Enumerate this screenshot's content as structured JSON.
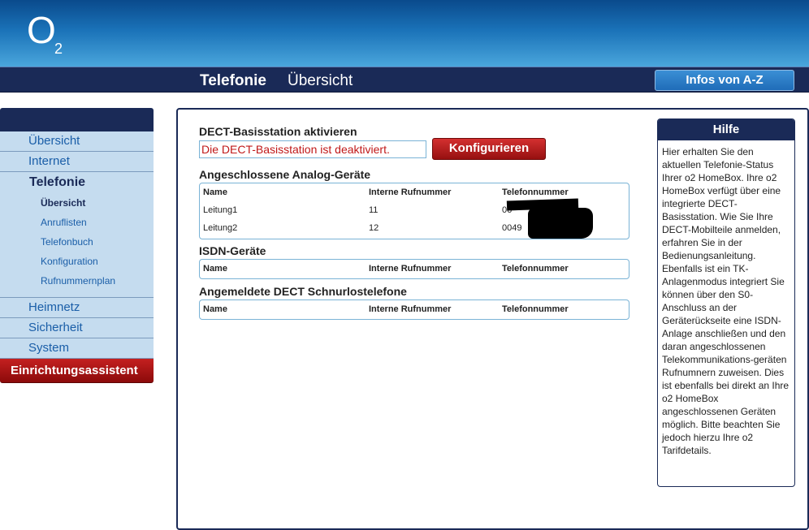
{
  "header": {
    "logo_main": "O",
    "logo_sub": "2",
    "title_bold": "Telefonie",
    "title_normal": "Übersicht",
    "infos_button": "Infos von A-Z"
  },
  "sidebar": {
    "items": [
      {
        "label": "Übersicht"
      },
      {
        "label": "Internet"
      },
      {
        "label": "Telefonie"
      },
      {
        "label": "Heimnetz"
      },
      {
        "label": "Sicherheit"
      },
      {
        "label": "System"
      }
    ],
    "sub_items": [
      {
        "label": "Übersicht"
      },
      {
        "label": "Anruflisten"
      },
      {
        "label": "Telefonbuch"
      },
      {
        "label": "Konfiguration"
      },
      {
        "label": "Rufnummernplan"
      }
    ],
    "wizard": "Einrichtungsassistent"
  },
  "main": {
    "dect_title": "DECT-Basisstation aktivieren",
    "dect_status": "Die DECT-Basisstation ist deaktiviert.",
    "config_button": "Konfigurieren",
    "analog_title": "Angeschlossene Analog-Geräte",
    "isdn_title": "ISDN-Geräte",
    "dect_phones_title": "Angemeldete DECT Schnurlostelefone",
    "columns": [
      "Name",
      "Interne Rufnummer",
      "Telefonnummer"
    ],
    "analog_rows": [
      {
        "name": "Leitung1",
        "internal": "11",
        "phone": "06"
      },
      {
        "name": "Leitung2",
        "internal": "12",
        "phone": "0049"
      }
    ]
  },
  "help": {
    "title": "Hilfe",
    "text": "Hier erhalten Sie den aktuellen Telefonie-Status Ihrer o2 HomeBox. Ihre o2 HomeBox verfügt über eine integrierte DECT-Basisstation. Wie Sie Ihre DECT-Mobilteile anmelden, erfahren Sie in der Bedienungsanleitung. Ebenfalls ist ein TK-Anlagenmodus integriert Sie können über den S0-Anschluss an der Geräterückseite eine ISDN-Anlage anschließen und den daran angeschlossenen Telekommunikations-geräten Rufnumnern zuweisen. Dies ist ebenfalls bei direkt an Ihre o2 HomeBox angeschlossenen Geräten möglich. Bitte beachten Sie jedoch hierzu Ihre o2 Tarifdetails."
  },
  "colors": {
    "navy": "#1a2a57",
    "nav_bg": "#c5dcef",
    "link_blue": "#1a5ea8",
    "red_button": "#b01a1a",
    "table_border": "#7ab3d6"
  }
}
